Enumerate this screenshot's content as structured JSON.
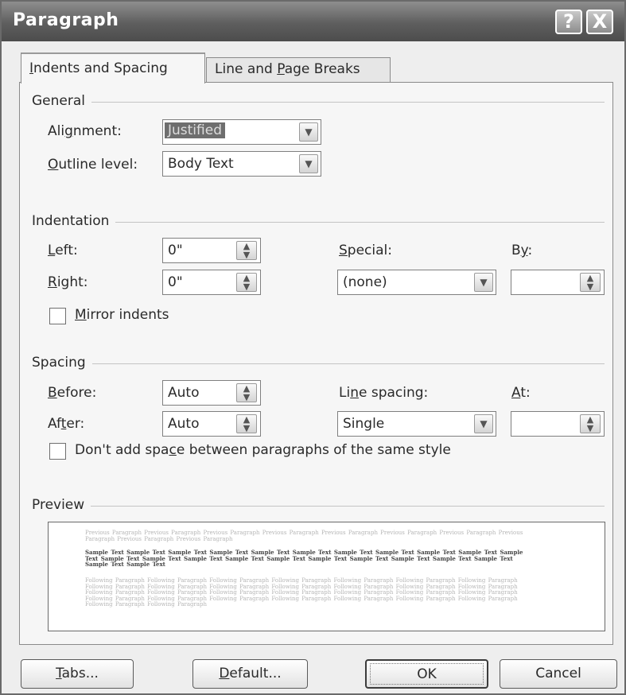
{
  "window": {
    "title": "Paragraph",
    "help_label": "?",
    "close_label": "X"
  },
  "tabs": [
    {
      "pre": "",
      "key": "I",
      "post": "ndents and Spacing",
      "active": true
    },
    {
      "pre": "Line and ",
      "key": "P",
      "post": "age Breaks",
      "active": false
    }
  ],
  "general": {
    "heading": "General",
    "alignment": {
      "pre": "Ali",
      "key": "g",
      "post": "nment:",
      "value": "Justified"
    },
    "outline": {
      "pre": "",
      "key": "O",
      "post": "utline level:",
      "value": "Body Text"
    }
  },
  "indentation": {
    "heading": "Indentation",
    "left": {
      "pre": "",
      "key": "L",
      "post": "eft:",
      "value": "0\""
    },
    "right": {
      "pre": "",
      "key": "R",
      "post": "ight:",
      "value": "0\""
    },
    "special": {
      "pre": "",
      "key": "S",
      "post": "pecial:",
      "value": "(none)"
    },
    "by": {
      "pre": "B",
      "key": "y",
      "post": ":",
      "value": ""
    },
    "mirror": {
      "pre": "",
      "key": "M",
      "post": "irror indents",
      "checked": false
    }
  },
  "spacing": {
    "heading": "Spacing",
    "before": {
      "pre": "",
      "key": "B",
      "post": "efore:",
      "value": "Auto"
    },
    "after": {
      "pre": "Af",
      "key": "t",
      "post": "er:",
      "value": "Auto"
    },
    "line_spacing": {
      "pre": "Li",
      "key": "n",
      "post": "e spacing:",
      "value": "Single"
    },
    "at": {
      "pre": "",
      "key": "A",
      "post": "t:",
      "value": ""
    },
    "dont_add": {
      "pre": "Don't add spa",
      "key": "c",
      "post": "e between paragraphs of the same style",
      "checked": false
    }
  },
  "preview": {
    "heading": "Preview",
    "previous_text": "Previous Paragraph Previous Paragraph Previous Paragraph Previous Paragraph Previous Paragraph Previous Paragraph Previous Paragraph Previous Paragraph Previous Paragraph Previous Paragraph",
    "sample_text": "Sample Text Sample Text Sample Text Sample Text Sample Text Sample Text Sample Text Sample Text Sample Text Sample Text Sample Text Sample Text Sample Text Sample Text Sample Text Sample Text Sample Text Sample Text Sample Text Sample Text Sample Text Sample Text Sample Text",
    "following_text": "Following Paragraph Following Paragraph Following Paragraph Following Paragraph Following Paragraph Following Paragraph Following Paragraph Following Paragraph Following Paragraph Following Paragraph Following Paragraph Following Paragraph Following Paragraph Following Paragraph Following Paragraph Following Paragraph Following Paragraph Following Paragraph Following Paragraph Following Paragraph Following Paragraph Following Paragraph Following Paragraph Following Paragraph Following Paragraph Following Paragraph Following Paragraph Following Paragraph Following Paragraph Following Paragraph"
  },
  "buttons": {
    "tabs": {
      "pre": "",
      "key": "T",
      "post": "abs..."
    },
    "default": {
      "pre": "",
      "key": "D",
      "post": "efault..."
    },
    "ok": "OK",
    "cancel": "Cancel"
  },
  "icons": {
    "dropdown_arrow": "chevron-down-icon",
    "spinner": "spin-up-down-icon"
  }
}
